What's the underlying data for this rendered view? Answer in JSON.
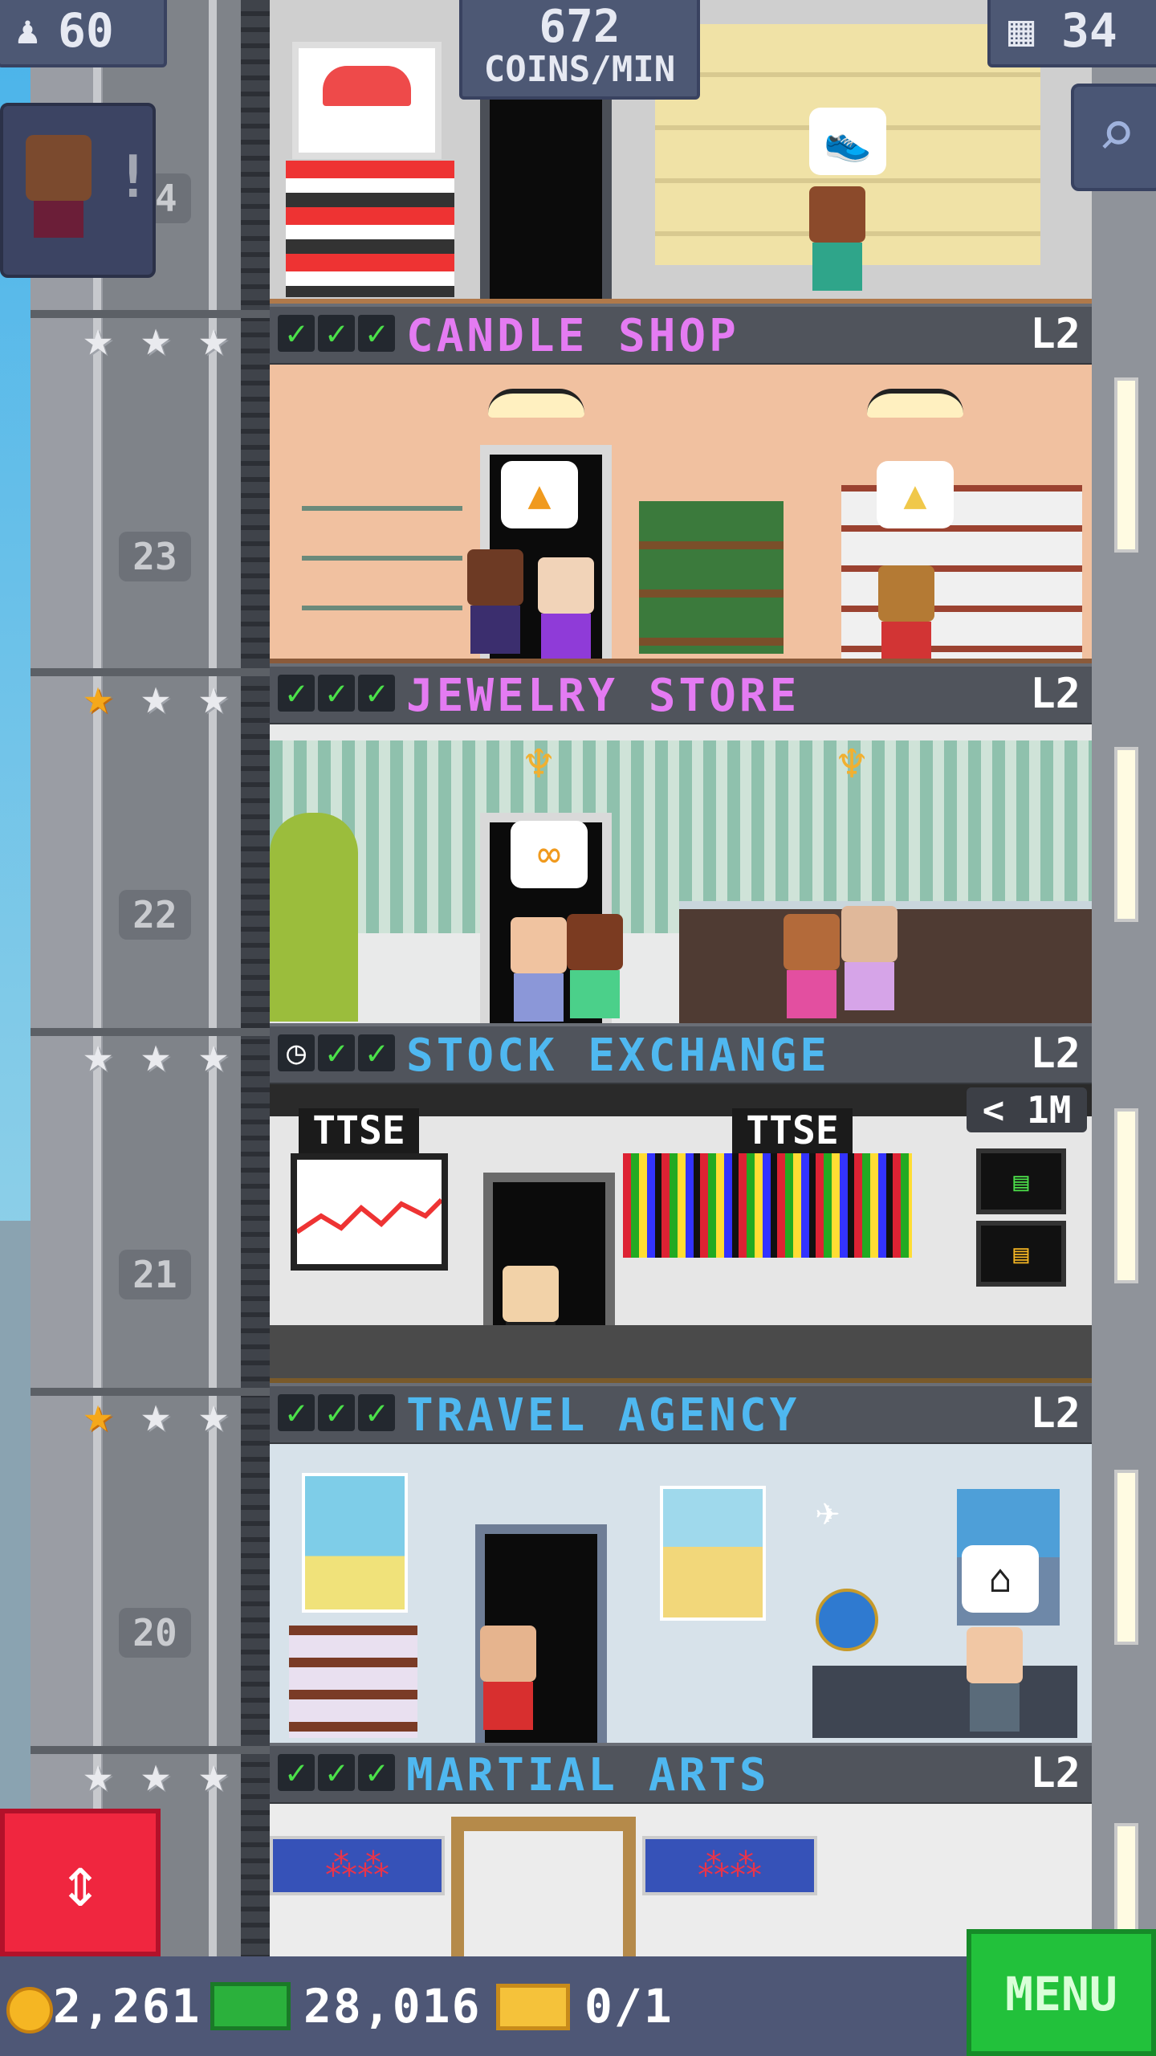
{
  "topbar": {
    "population": "60",
    "coins_per_min_value": "672",
    "coins_per_min_label": "COINS/MIN",
    "floors": "34"
  },
  "elevator_floor_top": "24",
  "floors": [
    {
      "number": "23",
      "name": "CANDLE SHOP",
      "level": "L2",
      "status": [
        "check",
        "check",
        "check"
      ],
      "stars": [
        "silver",
        "silver",
        "silver"
      ],
      "name_color": "#e47bf2"
    },
    {
      "number": "22",
      "name": "JEWELRY STORE",
      "level": "L2",
      "status": [
        "check",
        "check",
        "check"
      ],
      "stars": [
        "gold",
        "silver",
        "silver"
      ],
      "name_color": "#e47bf2"
    },
    {
      "number": "21",
      "name": "STOCK EXCHANGE",
      "level": "L2",
      "status": [
        "clock",
        "check",
        "check"
      ],
      "stars": [
        "silver",
        "silver",
        "silver"
      ],
      "name_color": "#4fb8f0"
    },
    {
      "number": "20",
      "name": "TRAVEL AGENCY",
      "level": "L2",
      "status": [
        "check",
        "check",
        "check"
      ],
      "stars": [
        "gold",
        "silver",
        "silver"
      ],
      "name_color": "#4fb8f0"
    },
    {
      "number": "",
      "name": "MARTIAL ARTS",
      "level": "L2",
      "status": [
        "check",
        "check",
        "check"
      ],
      "stars": [
        "silver",
        "silver",
        "silver"
      ],
      "name_color": "#4fb8f0"
    }
  ],
  "stock_exchange": {
    "sign_left": "TTSE",
    "sign_right": "TTSE",
    "timer": "< 1M"
  },
  "bottombar": {
    "coins": "2,261",
    "bux": "28,016",
    "tickets": "0/1",
    "menu_label": "MENU"
  },
  "icons": {
    "population": "person-icon",
    "floors": "building-icon",
    "search": "magnifier-icon",
    "elevator": "up-down-arrows-icon",
    "coin": "coin-icon",
    "bux": "banknote-icon",
    "ticket": "ticket-icon",
    "check": "check-icon",
    "clock": "clock-icon",
    "star": "star-icon"
  },
  "colors": {
    "bar": "#4e5776",
    "menu": "#22c13b",
    "elevator_button": "#f0263f",
    "shop_pink": "#e47bf2",
    "shop_blue": "#4fb8f0"
  }
}
